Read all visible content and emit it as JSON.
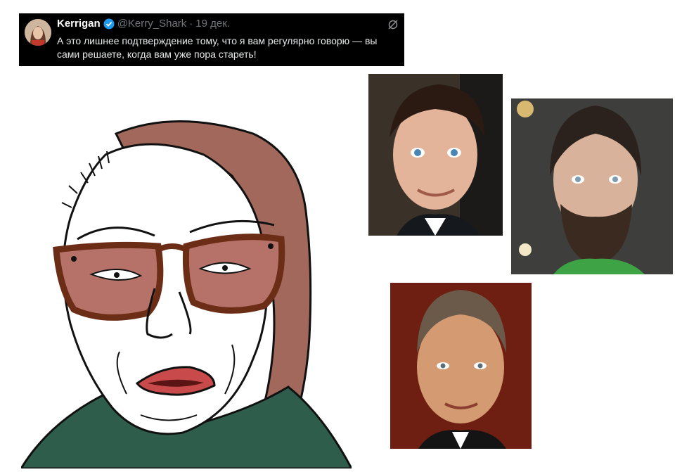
{
  "tweet": {
    "author": "Kerrigan",
    "handle": "@Kerry_Shark",
    "separator": "·",
    "date": "19 дек.",
    "text": "А это лишнее подтверждение тому, что я вам регулярно говорю — вы сами решаете, когда вам уже пора стареть!",
    "verified_icon": "verified-badge-icon",
    "action_icon": "grok-icon",
    "colors": {
      "background": "#000000",
      "text": "#e7e9ea",
      "muted": "#71767b",
      "verified": "#1d9bf0"
    }
  },
  "images": [
    {
      "name": "wojak-old-woman-drawing"
    },
    {
      "name": "man-photo-1"
    },
    {
      "name": "man-photo-2"
    },
    {
      "name": "man-photo-3"
    }
  ]
}
